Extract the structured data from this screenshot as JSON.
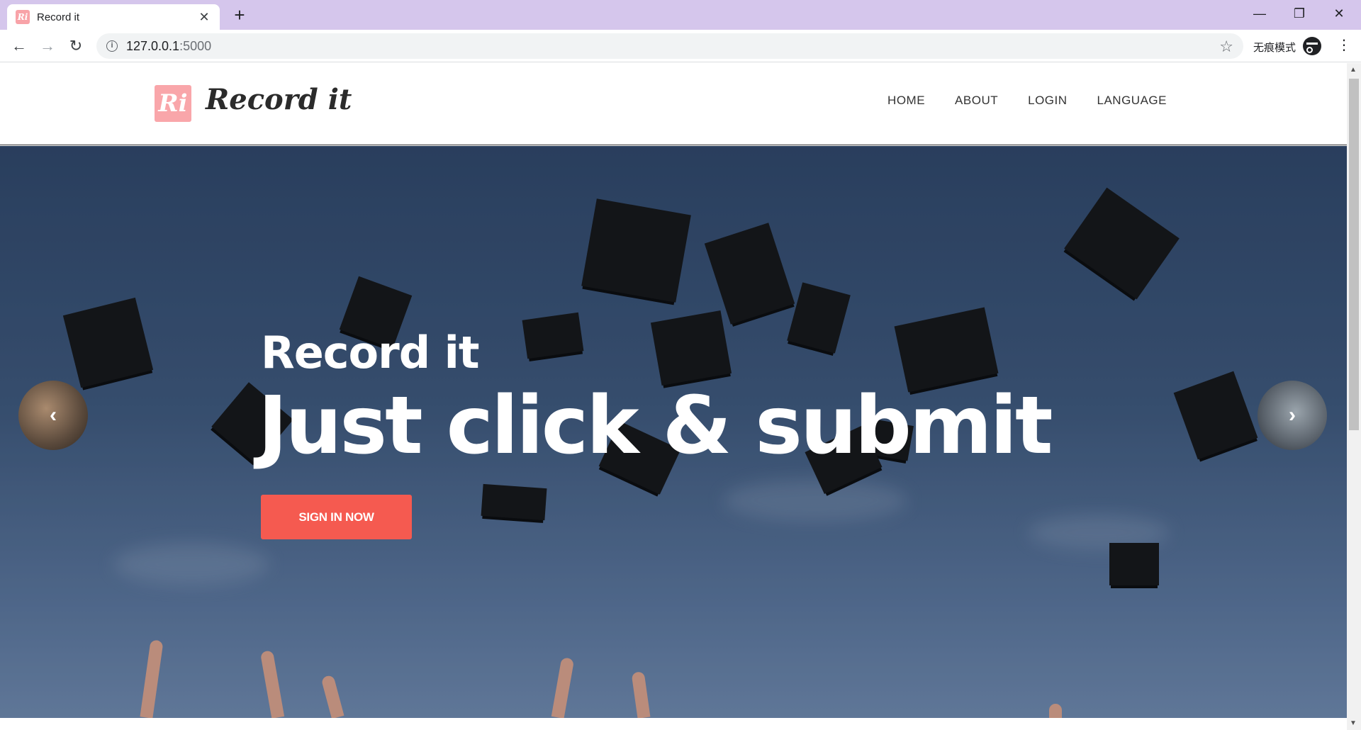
{
  "browser": {
    "tab": {
      "favicon_text": "Ri",
      "title": "Record it",
      "close_glyph": "✕"
    },
    "new_tab_glyph": "+",
    "window_controls": {
      "minimize": "—",
      "restore": "❐",
      "close": "✕"
    },
    "nav": {
      "back": "←",
      "forward": "→",
      "reload": "↻"
    },
    "address": {
      "host": "127.0.0.1",
      "port": ":5000",
      "info_glyph": "i"
    },
    "bookmark_glyph": "☆",
    "incognito_label": "无痕模式",
    "menu_glyph": "⋮"
  },
  "site": {
    "logo_mark": "Ri",
    "logo_text": "Record it",
    "nav": [
      "HOME",
      "ABOUT",
      "LOGIN",
      "LANGUAGE"
    ]
  },
  "hero": {
    "subtitle": "Record it",
    "title": "Just click & submit",
    "cta": "SIGN IN NOW",
    "prev_glyph": "‹",
    "next_glyph": "›"
  },
  "colors": {
    "tab_strip": "#d5c6ec",
    "logo_pink": "#f9a6aa",
    "cta_red": "#f55a50",
    "sky": "#3d5678"
  }
}
